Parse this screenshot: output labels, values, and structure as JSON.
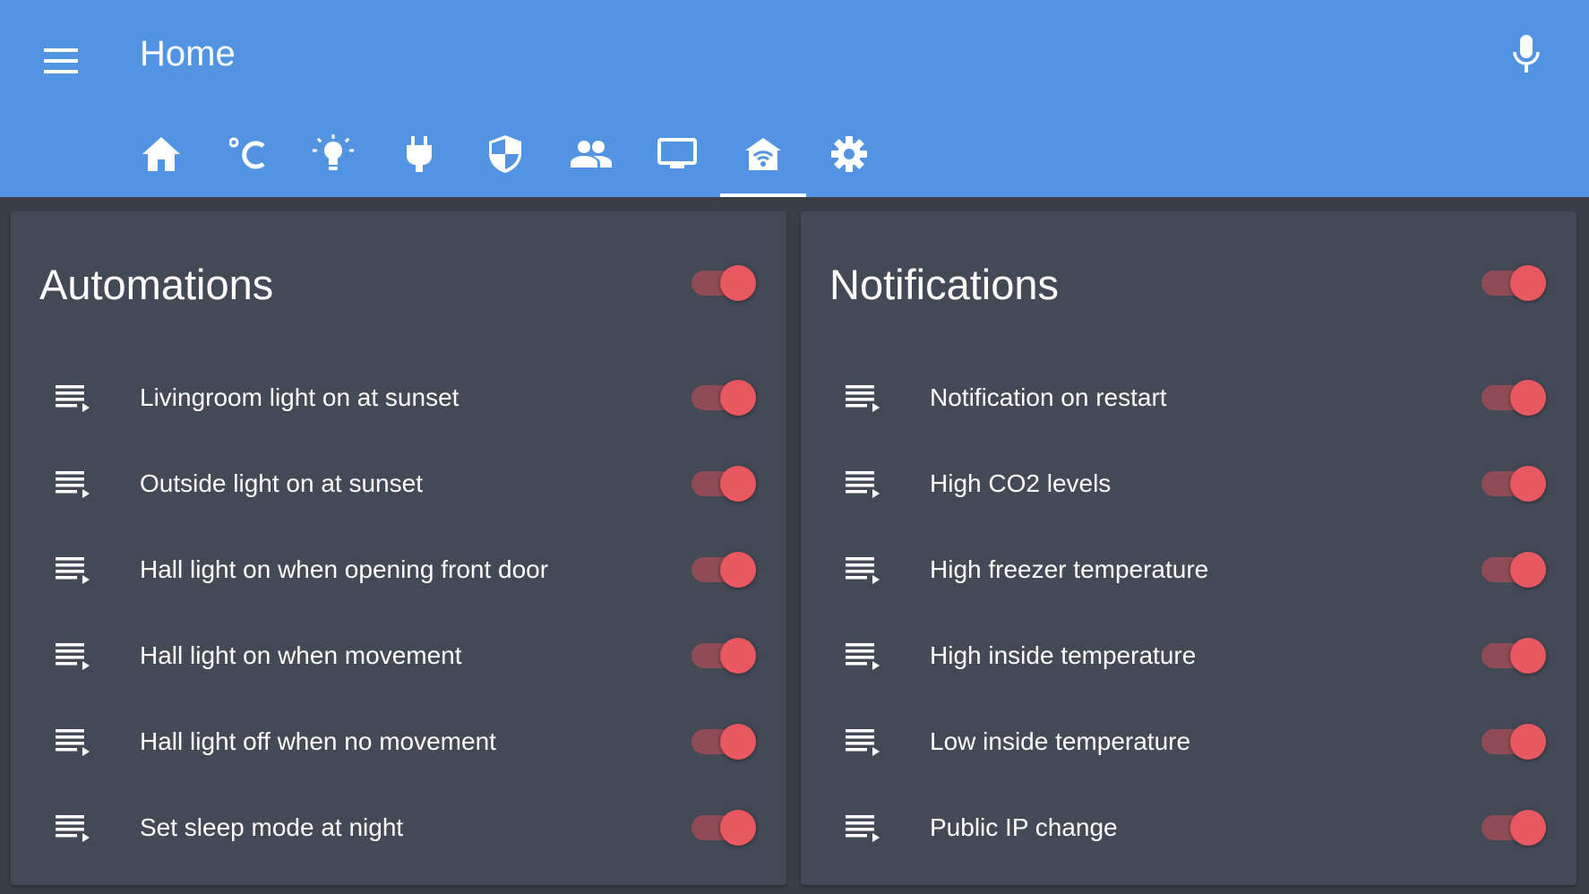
{
  "header": {
    "title": "Home",
    "menu_icon": "hamburger-menu-icon",
    "mic_icon": "microphone-icon",
    "tabs": [
      {
        "icon": "home-icon",
        "active": false
      },
      {
        "icon": "celsius-icon",
        "active": false
      },
      {
        "icon": "lightbulb-icon",
        "active": false
      },
      {
        "icon": "power-plug-icon",
        "active": false
      },
      {
        "icon": "shield-icon",
        "active": false
      },
      {
        "icon": "people-icon",
        "active": false
      },
      {
        "icon": "monitor-icon",
        "active": false
      },
      {
        "icon": "home-wifi-icon",
        "active": true
      },
      {
        "icon": "gear-icon",
        "active": false
      }
    ]
  },
  "colors": {
    "header_bg": "#5294e2",
    "page_bg": "#3a3f47",
    "card_bg": "#434955",
    "toggle_on": "#e85861",
    "toggle_track": "#8f4b56"
  },
  "automations": {
    "title": "Automations",
    "enabled": true,
    "items": [
      {
        "label": "Livingroom light on at sunset",
        "enabled": true
      },
      {
        "label": "Outside light on at sunset",
        "enabled": true
      },
      {
        "label": "Hall light on when opening front door",
        "enabled": true
      },
      {
        "label": "Hall light on when movement",
        "enabled": true
      },
      {
        "label": "Hall light off when no movement",
        "enabled": true
      },
      {
        "label": "Set sleep mode at night",
        "enabled": true
      }
    ]
  },
  "notifications": {
    "title": "Notifications",
    "enabled": true,
    "items": [
      {
        "label": "Notification on restart",
        "enabled": true
      },
      {
        "label": "High CO2 levels",
        "enabled": true
      },
      {
        "label": "High freezer temperature",
        "enabled": true
      },
      {
        "label": "High inside temperature",
        "enabled": true
      },
      {
        "label": "Low inside temperature",
        "enabled": true
      },
      {
        "label": "Public IP change",
        "enabled": true
      }
    ]
  }
}
